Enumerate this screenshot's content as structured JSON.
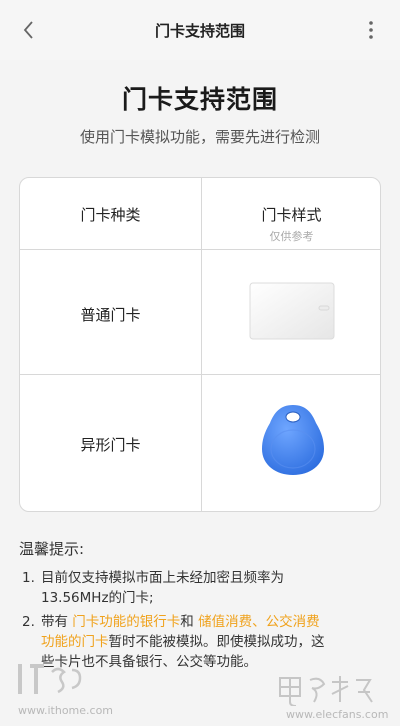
{
  "topbar": {
    "title": "门卡支持范围",
    "back_icon": "chevron-left-icon",
    "more_icon": "more-vertical-icon"
  },
  "header": {
    "title": "门卡支持范围",
    "subtitle": "使用门卡模拟功能，需要先进行检测"
  },
  "table": {
    "col1_header": "门卡种类",
    "col2_header": "门卡样式",
    "col2_subheader": "仅供参考",
    "rows": [
      {
        "type": "普通门卡",
        "image": "white-rectangular-card"
      },
      {
        "type": "异形门卡",
        "image": "blue-keyfob-tag"
      }
    ]
  },
  "tips": {
    "title": "温馨提示:",
    "item1": {
      "num": "1.",
      "line1": "目前仅支持模拟市面上未经加密且频率为",
      "line2": "13.56MHz的门卡;"
    },
    "item2": {
      "num": "2.",
      "p1": "带有 ",
      "h1": "门卡功能的银行卡",
      "p2": "和 ",
      "h2": "储值消费、公交消费",
      "h3": "功能的门卡",
      "p3": "暂时不能被模拟。即使模拟成功，这",
      "line3": "些卡片也不具备银行、公交等功能。"
    }
  },
  "watermarks": {
    "left_url": "www.ithome.com",
    "right_url": "www.elecfans.com"
  },
  "colors": {
    "highlight": "#f0a21c",
    "background": "#f4f4f4",
    "card": "#ffffff",
    "keyfob": "#3b7de8"
  }
}
